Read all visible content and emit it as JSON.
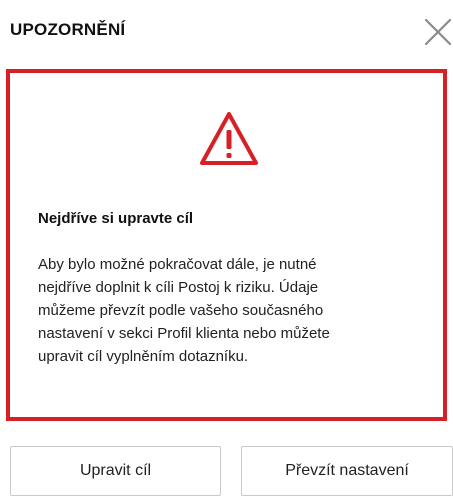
{
  "dialog": {
    "title": "UPOZORNĚNÍ",
    "close_icon": "close-icon",
    "accent_color": "#d81f26"
  },
  "alert": {
    "icon": "warning-triangle-icon",
    "heading": "Nejdříve si upravte cíl",
    "text_lines": [
      "Aby bylo možné pokračovat dále, je nutné",
      "nejdříve doplnit k cíli Postoj k riziku. Údaje",
      "můžeme převzít podle vašeho současného",
      "nastavení v sekci Profil klienta nebo můžete",
      "upravit cíl vyplněním dotazníku."
    ]
  },
  "actions": {
    "edit_label": "Upravit cíl",
    "take_label": "Převzít nastavení"
  }
}
